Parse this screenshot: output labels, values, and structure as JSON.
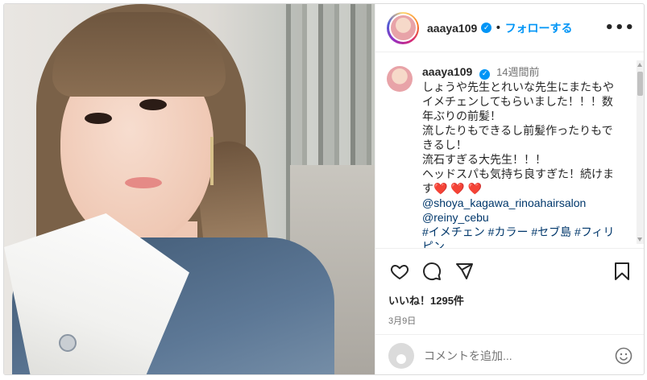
{
  "header": {
    "username": "aaaya109",
    "verified_symbol": "✓",
    "separator": "•",
    "follow_label": "フォローする",
    "more_label": "•••"
  },
  "caption": {
    "username": "aaaya109",
    "time": "14週間前",
    "lines": [
      "しょうや先生とれいな先生にまたもや",
      "イメチェンしてもらいました！！！数",
      "年ぶりの前髪！",
      "流したりもできるし前髪作ったりもで",
      "きるし！",
      "流石すぎる大先生！！！",
      "ヘッドスパも気持ち良すぎた！続けま"
    ],
    "last_line_prefix": "す",
    "hearts": "❤️ ❤️ ❤️",
    "mention_1": "@shoya_kagawa_rinoahairsalon",
    "mention_2": "@reiny_cebu",
    "hashtags": "#イメチェン #カラー #セブ島 #フィリ",
    "hashtags_cut": "ピン"
  },
  "actions": {
    "like_icon": "heart-outline-icon",
    "comment_icon": "comment-bubble-icon",
    "share_icon": "paper-plane-icon",
    "save_icon": "bookmark-icon"
  },
  "likes_text": "いいね！1295件",
  "date_text": "3月9日",
  "comment_box": {
    "placeholder": "コメントを追加...",
    "emoji_icon": "smiley-icon"
  },
  "colors": {
    "accent": "#0095f6",
    "text": "#262626",
    "muted": "#737373",
    "link": "#00376b",
    "border": "#efefef"
  }
}
